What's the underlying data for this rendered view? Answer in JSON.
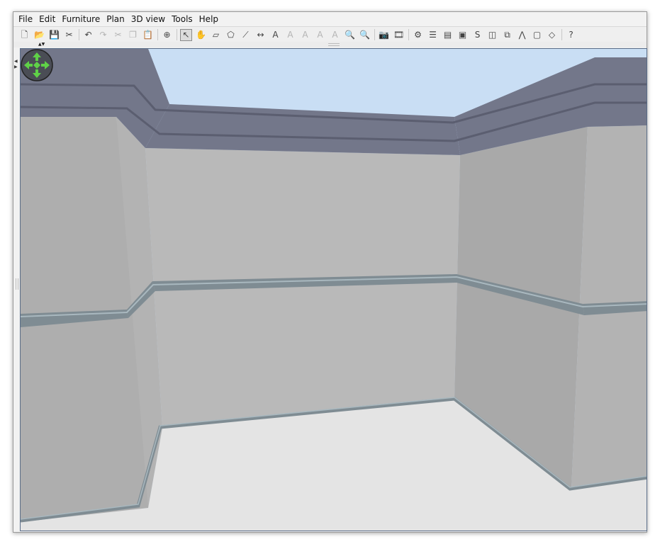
{
  "menu": [
    {
      "label": "File"
    },
    {
      "label": "Edit"
    },
    {
      "label": "Furniture"
    },
    {
      "label": "Plan"
    },
    {
      "label": "3D view"
    },
    {
      "label": "Tools"
    },
    {
      "label": "Help"
    }
  ],
  "toolbar": {
    "groups": [
      [
        {
          "name": "new-home-icon",
          "glyph": "🗋"
        },
        {
          "name": "open-icon",
          "glyph": "📂"
        },
        {
          "name": "save-icon",
          "glyph": "💾"
        },
        {
          "name": "preferences-icon",
          "glyph": "✂"
        }
      ],
      [
        {
          "name": "undo-icon",
          "glyph": "↶"
        },
        {
          "name": "redo-icon",
          "glyph": "↷",
          "dim": true
        },
        {
          "name": "cut-icon",
          "glyph": "✂",
          "dim": true
        },
        {
          "name": "copy-icon",
          "glyph": "❐",
          "dim": true
        },
        {
          "name": "paste-icon",
          "glyph": "📋",
          "dim": true
        }
      ],
      [
        {
          "name": "add-furniture-icon",
          "glyph": "⊕"
        }
      ],
      [
        {
          "name": "select-mode-icon",
          "glyph": "↖",
          "selected": true
        },
        {
          "name": "pan-mode-icon",
          "glyph": "✋"
        },
        {
          "name": "create-walls-icon",
          "glyph": "▱"
        },
        {
          "name": "create-rooms-icon",
          "glyph": "⬠"
        },
        {
          "name": "create-polylines-icon",
          "glyph": "⟋"
        },
        {
          "name": "create-dimensions-icon",
          "glyph": "↔"
        },
        {
          "name": "add-text-icon",
          "glyph": "A"
        },
        {
          "name": "text-style-icon",
          "glyph": "A",
          "dim": true
        },
        {
          "name": "increase-text-size-icon",
          "glyph": "A",
          "dim": true
        },
        {
          "name": "bold-text-icon",
          "glyph": "A",
          "dim": true
        },
        {
          "name": "italic-text-icon",
          "glyph": "A",
          "dim": true
        },
        {
          "name": "zoom-in-icon",
          "glyph": "🔍"
        },
        {
          "name": "zoom-out-icon",
          "glyph": "🔍"
        }
      ],
      [
        {
          "name": "create-photo-icon",
          "glyph": "📷"
        },
        {
          "name": "create-video-icon",
          "glyph": "🎞"
        }
      ],
      [
        {
          "name": "plugin-icon-1",
          "glyph": "⚙"
        },
        {
          "name": "plugin-icon-2",
          "glyph": "☰"
        },
        {
          "name": "plugin-icon-3",
          "glyph": "▤"
        },
        {
          "name": "plugin-icon-4",
          "glyph": "▣"
        },
        {
          "name": "plugin-icon-5",
          "glyph": "S"
        },
        {
          "name": "plugin-icon-6",
          "glyph": "◫"
        },
        {
          "name": "plugin-icon-7",
          "glyph": "⧉"
        },
        {
          "name": "plugin-icon-8",
          "glyph": "⋀"
        },
        {
          "name": "plugin-icon-9",
          "glyph": "▢"
        },
        {
          "name": "plugin-icon-10",
          "glyph": "◇"
        }
      ],
      [
        {
          "name": "help-icon",
          "glyph": "?"
        }
      ]
    ]
  },
  "colors": {
    "sky": "#c9def4",
    "floor": "#e4e4e4",
    "back_wall": "#b9b9b9",
    "left_wall": "#aeaeae",
    "right_wall": "#a9a9a9",
    "side_face": "#b3b3b3",
    "cornice": "#73778a",
    "cornice_dark": "#5b5e70",
    "rail": "#7f8c93",
    "rail_light": "#a9b8bf",
    "navigator_green": "#5fd147"
  }
}
